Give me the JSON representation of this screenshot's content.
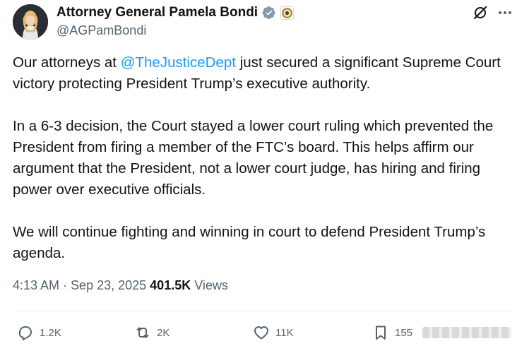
{
  "author": {
    "name": "Attorney General Pamela Bondi",
    "handle": "@AGPamBondi"
  },
  "tweet": {
    "p1_before": "Our attorneys at ",
    "mention": "@TheJusticeDept",
    "p1_after": " just secured a significant Supreme Court victory protecting President Trump’s executive authority.",
    "p2": "In a 6-3 decision, the Court stayed a lower court ruling which prevented the President from firing a member of the FTC’s board. This helps affirm our argument that the President, not a lower court judge, has hiring and firing power over executive officials.",
    "p3": "We will continue fighting and winning in court to defend President Trump’s agenda."
  },
  "meta": {
    "time": "4:13 AM",
    "separator": " · ",
    "date": "Sep 23, 2025",
    "views_count": "401.5K",
    "views_label": "Views"
  },
  "actions": {
    "replies": "1.2K",
    "reposts": "2K",
    "likes": "11K",
    "bookmarks": "155"
  },
  "icons": {
    "verified": "verified-badge-icon",
    "affiliate": "doj-seal-icon",
    "grok": "grok-icon",
    "more": "more-icon",
    "reply": "reply-icon",
    "repost": "repost-icon",
    "like": "like-icon",
    "bookmark": "bookmark-icon"
  },
  "colors": {
    "text": "#0f1419",
    "secondary": "#536471",
    "link": "#1d9bf0",
    "verified": "#829aab"
  }
}
